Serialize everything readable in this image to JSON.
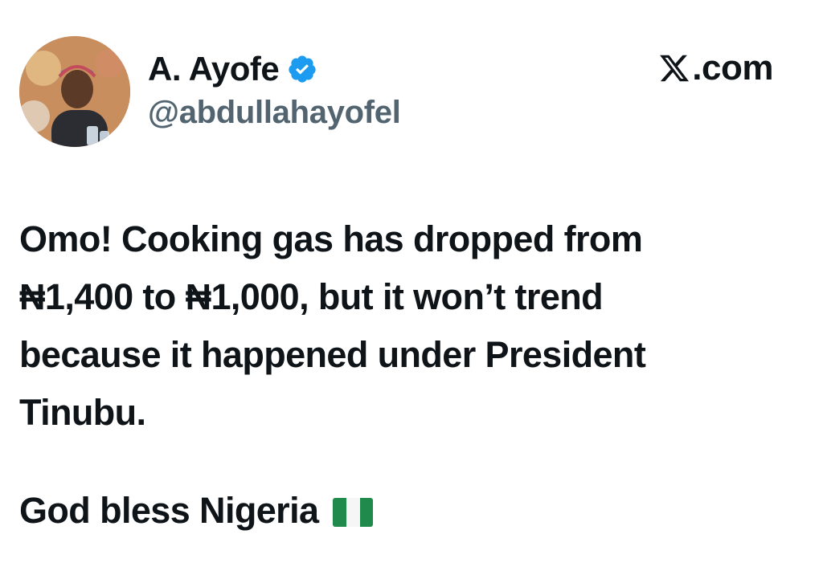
{
  "author": {
    "display_name": "A. Ayofe",
    "handle": "@abdullahayofel",
    "verified": true,
    "verified_color": "#1d9bf0",
    "avatar_icon": "profile-photo"
  },
  "site": {
    "domain": ".com",
    "logo_icon": "x-logo"
  },
  "tweet": {
    "text": "Omo! Cooking gas has dropped from\n₦1,400 to ₦1,000, but it won’t trend\nbecause it happened under President\nTinubu.",
    "closing_text": "God bless Nigeria",
    "closing_icon": "nigeria-flag-emoji"
  },
  "colors": {
    "text_primary": "#0f1419",
    "text_secondary": "#536471",
    "flag_green": "#1f8a4c"
  }
}
